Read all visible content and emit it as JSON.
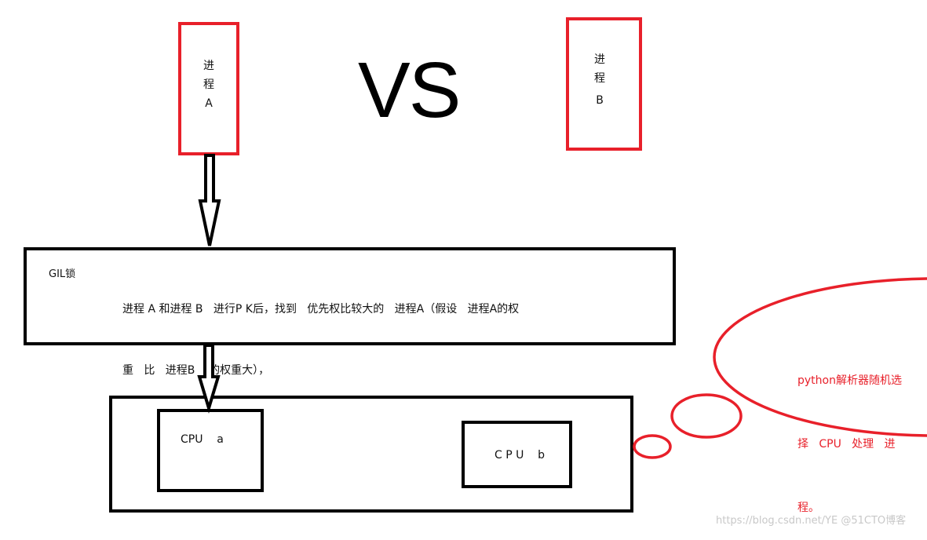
{
  "process_a": {
    "line1": "进",
    "line2": "程",
    "line3": "A"
  },
  "process_b": {
    "line1": "进",
    "line2": "程",
    "line3": "B"
  },
  "vs_label": "VS",
  "gil_box": {
    "label": "GIL锁",
    "text_line1": "进程 A 和进程 B   进行P K后，找到   优先权比较大的   进程A（假设   进程A的权",
    "text_line2": "重   比   进程B    的权重大），"
  },
  "cpu_container": {
    "cpu_a": "CPU    a",
    "cpu_b": "C P U    b"
  },
  "thought_bubble": {
    "text_line1": "python解析器随机选",
    "text_line2": "择   CPU   处理   进",
    "text_line3": "程。"
  },
  "watermark": "https://blog.csdn.net/YE @51CTO博客",
  "colors": {
    "accent_red": "#e8202a",
    "outline": "#000000"
  }
}
